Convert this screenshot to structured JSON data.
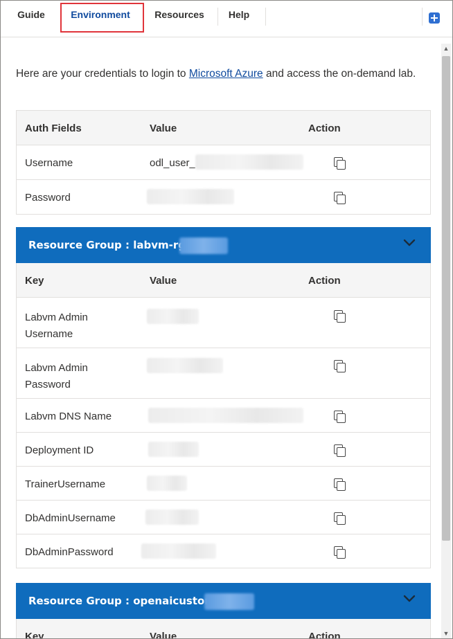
{
  "tabs": [
    {
      "label": "Guide"
    },
    {
      "label": "Environment"
    },
    {
      "label": "Resources"
    },
    {
      "label": "Help"
    }
  ],
  "intro": {
    "before": "Here are your credentials to login to ",
    "link": "Microsoft Azure",
    "after": " and access the on-demand lab."
  },
  "auth_table": {
    "headers": [
      "Auth Fields",
      "Value",
      "Action"
    ],
    "rows": [
      {
        "field": "Username",
        "value": "odl_user_"
      },
      {
        "field": "Password",
        "value": ""
      }
    ]
  },
  "resource_group_1": {
    "title": "Resource Group : labvm-rg-",
    "headers": [
      "Key",
      "Value",
      "Action"
    ],
    "rows": [
      {
        "key_line1": "Labvm Admin",
        "key_line2": "Username"
      },
      {
        "key_line1": "Labvm Admin",
        "key_line2": "Password"
      },
      {
        "key": "Labvm DNS Name"
      },
      {
        "key": "Deployment ID"
      },
      {
        "key": "TrainerUsername"
      },
      {
        "key": "DbAdminUsername"
      },
      {
        "key": "DbAdminPassword"
      }
    ]
  },
  "resource_group_2": {
    "title": "Resource Group : openaicustom-",
    "headers": [
      "Key",
      "Value",
      "Action"
    ]
  },
  "icons": {
    "copy": "copy-icon",
    "chevron": "chevron-down-icon",
    "extension": "extension-icon"
  },
  "colors": {
    "accent": "#0f6cbd",
    "active_tab": "#0f4a9e",
    "highlight": "#e0343a"
  }
}
